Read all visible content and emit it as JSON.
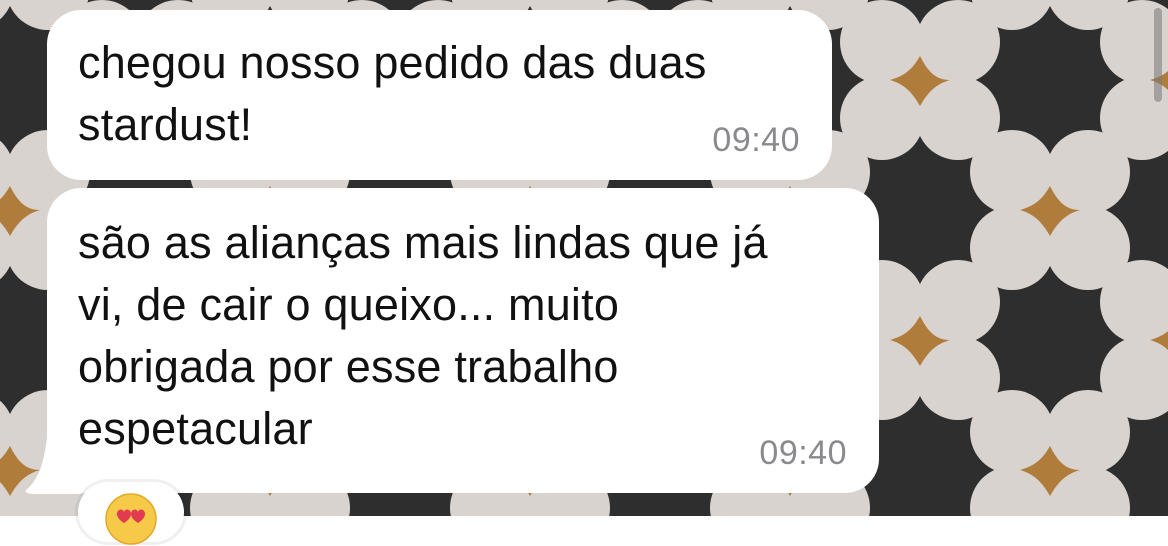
{
  "chat": {
    "messages": [
      {
        "text": "chegou nosso pedido das duas\nstardust!",
        "time": "09:40"
      },
      {
        "text": "são as alianças mais lindas que já\nvi, de cair o queixo... muito\nobrigada por esse trabalho\nespetacular",
        "time": "09:40"
      }
    ],
    "reaction": {
      "icon": "smiling-face-with-heart-eyes-icon"
    }
  },
  "colors": {
    "bubble": "#ffffff",
    "wallpaper_dark": "#2e2e2e",
    "wallpaper_petal": "#d8d3ce",
    "wallpaper_star": "#b07c3c",
    "timestamp": "#8a8a8e"
  }
}
